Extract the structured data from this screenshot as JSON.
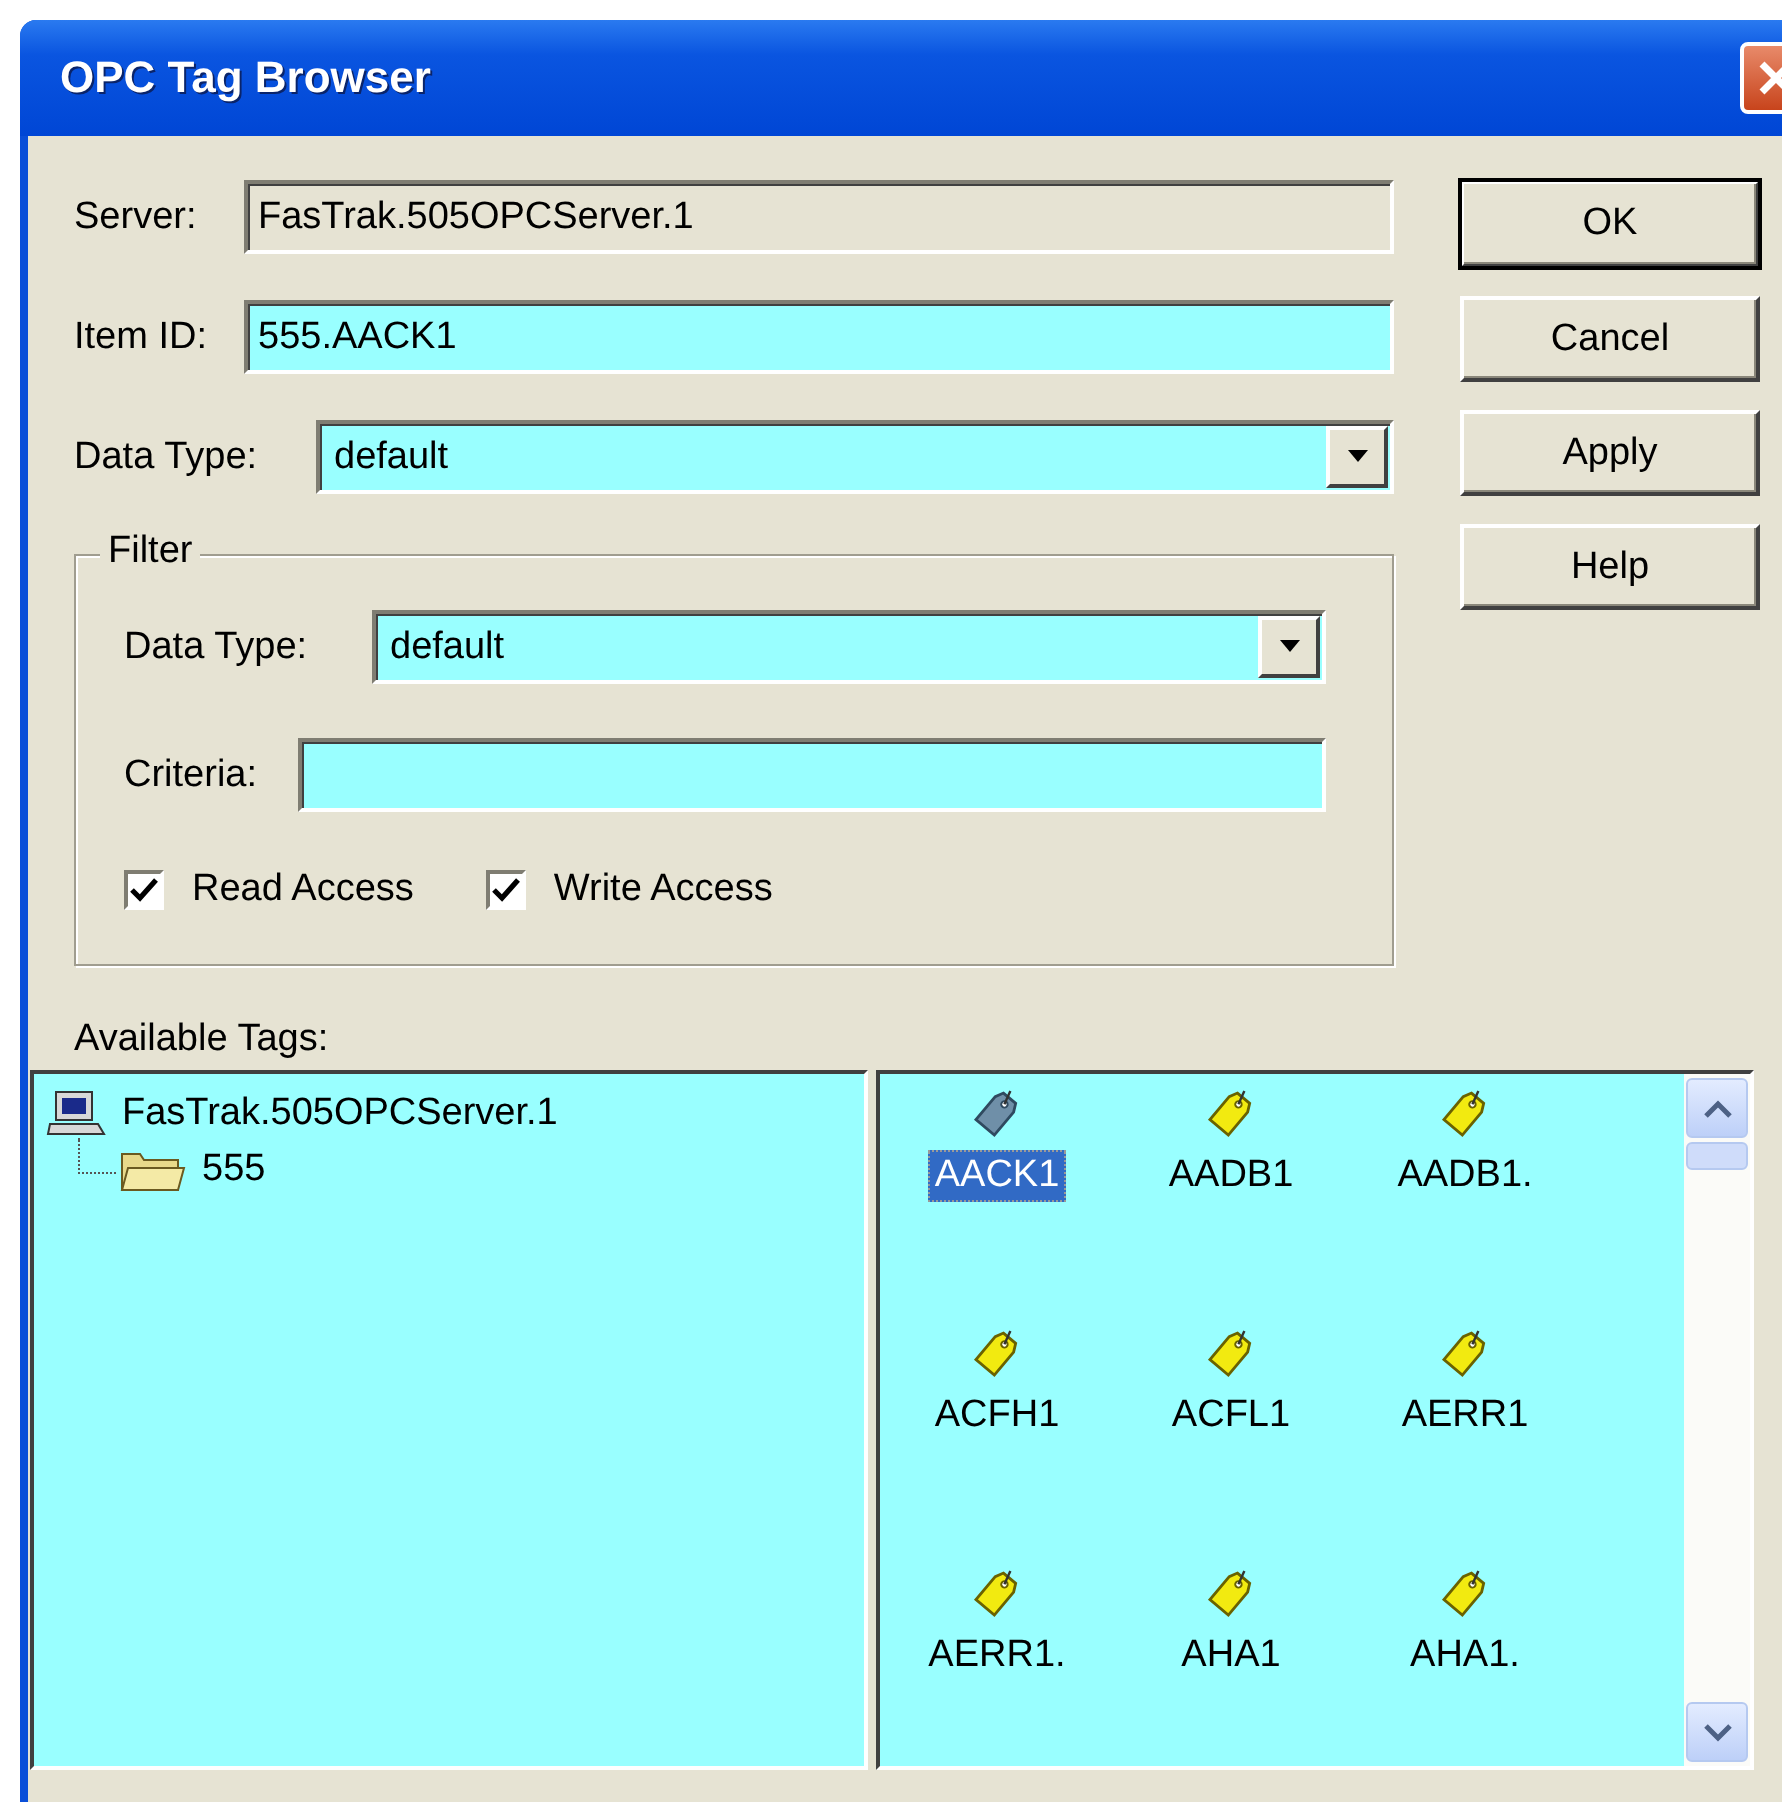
{
  "window": {
    "title": "OPC Tag Browser"
  },
  "server": {
    "label": "Server:",
    "value": "FasTrak.505OPCServer.1",
    "disabled": true
  },
  "item_id": {
    "label": "Item ID:",
    "value": "555.AACK1"
  },
  "data_type": {
    "label": "Data Type:",
    "value": "default"
  },
  "filter": {
    "title": "Filter",
    "data_type": {
      "label": "Data Type:",
      "value": "default"
    },
    "criteria": {
      "label": "Criteria:"
    },
    "checkboxes": [
      {
        "label": "Read Access",
        "checked": true
      },
      {
        "label": "Write Access",
        "checked": true
      }
    ]
  },
  "buttons": [
    {
      "label": "OK",
      "default": true
    },
    {
      "label": "Cancel",
      "default": false
    },
    {
      "label": "Apply",
      "default": false
    },
    {
      "label": "Help",
      "default": false
    }
  ],
  "available_tags": {
    "label": "Available Tags:"
  },
  "tree": [
    {
      "label": "FasTrak.505OPCServer.1",
      "kind": "computer",
      "children": [
        {
          "label": "555",
          "kind": "folder"
        }
      ]
    }
  ],
  "tags": [
    {
      "label": "AACK1",
      "selected": true
    },
    {
      "label": "AADB1",
      "selected": false
    },
    {
      "label": "AADB1.",
      "selected": false
    },
    {
      "label": "ACFH1",
      "selected": false
    },
    {
      "label": "ACFL1",
      "selected": false
    },
    {
      "label": "AERR1",
      "selected": false
    },
    {
      "label": "AERR1.",
      "selected": false
    },
    {
      "label": "AHA1",
      "selected": false
    },
    {
      "label": "AHA1.",
      "selected": false
    }
  ]
}
